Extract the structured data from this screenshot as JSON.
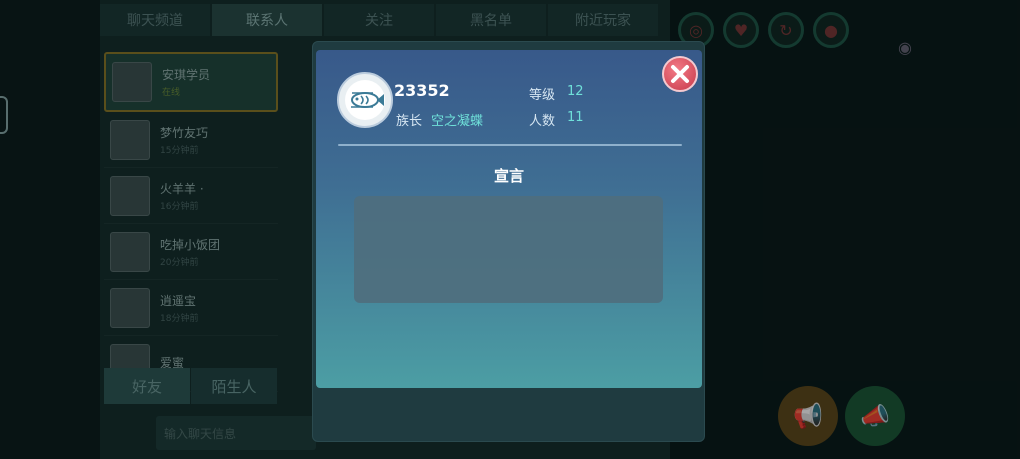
{
  "background": {
    "tabs": [
      "聊天频道",
      "联系人",
      "关注",
      "黑名单",
      "附近玩家"
    ],
    "active_tab_index": 1,
    "contacts": [
      {
        "name": "安琪学员",
        "sub": "在线"
      },
      {
        "name": "梦竹友巧",
        "sub": "15分钟前"
      },
      {
        "name": "火羊羊 ·",
        "sub": "16分钟前"
      },
      {
        "name": "吃掉小饭团",
        "sub": "20分钟前"
      },
      {
        "name": "逍遥宝",
        "sub": "18分钟前"
      },
      {
        "name": "爱蜜",
        "sub": ""
      }
    ],
    "bottom_tabs": [
      "好友",
      "陌生人"
    ],
    "chat_placeholder": "输入聊天信息"
  },
  "modal": {
    "guild_id": "23352",
    "leader_label": "族长",
    "leader_value": "空之凝蝶",
    "level_label": "等级",
    "level_value": "12",
    "members_label": "人数",
    "members_value": "11",
    "declaration_title": "宣言",
    "declaration_text": ""
  },
  "colors": {
    "accent_cyan": "#6fe0d9",
    "close_red": "#d84a5a"
  },
  "icons": {
    "guild_avatar": "fish-icon",
    "close": "close-icon"
  }
}
